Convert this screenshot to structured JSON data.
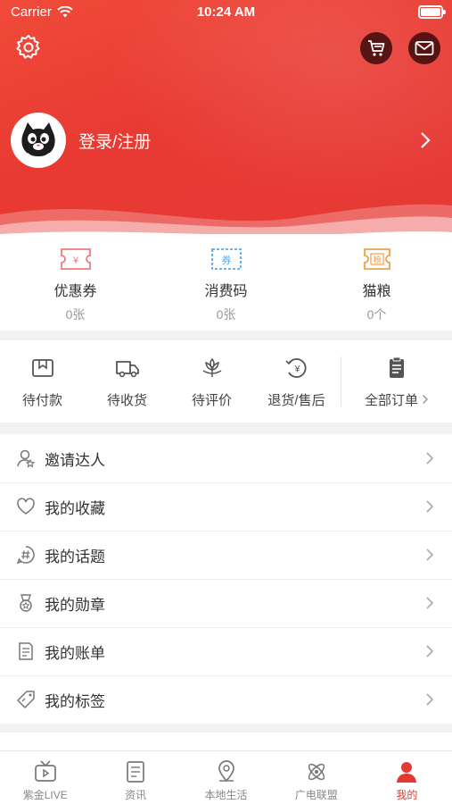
{
  "status_bar": {
    "carrier": "Carrier",
    "time": "10:24 AM"
  },
  "profile": {
    "login_label": "登录/注册"
  },
  "coupons": [
    {
      "name": "优惠券",
      "value": "0张",
      "icon": "coupon-icon",
      "color": "#f07b7b"
    },
    {
      "name": "消费码",
      "value": "0张",
      "icon": "voucher-icon",
      "color": "#5aa7e8"
    },
    {
      "name": "猫粮",
      "value": "0个",
      "icon": "cat-food-icon",
      "color": "#f0a24a"
    }
  ],
  "coupon_glyphs": {
    "voucher": "券",
    "cat_food": "粮",
    "yen": "¥"
  },
  "orders": [
    {
      "label": "待付款",
      "icon": "wallet-icon"
    },
    {
      "label": "待收货",
      "icon": "truck-icon"
    },
    {
      "label": "待评价",
      "icon": "flower-icon"
    },
    {
      "label": "退货/售后",
      "icon": "refund-icon"
    }
  ],
  "all_orders": {
    "label": "全部订单",
    "icon": "clipboard-icon"
  },
  "menu": [
    {
      "label": "邀请达人",
      "icon": "invite-user-icon"
    },
    {
      "label": "我的收藏",
      "icon": "heart-icon"
    },
    {
      "label": "我的话题",
      "icon": "hashtag-icon"
    },
    {
      "label": "我的勋章",
      "icon": "medal-icon"
    },
    {
      "label": "我的账单",
      "icon": "bill-icon"
    },
    {
      "label": "我的标签",
      "icon": "tag-icon"
    }
  ],
  "tabs": [
    {
      "label": "紫金LIVE",
      "icon": "tv-icon",
      "active": false
    },
    {
      "label": "资讯",
      "icon": "news-icon",
      "active": false
    },
    {
      "label": "本地生活",
      "icon": "location-icon",
      "active": false
    },
    {
      "label": "广电联盟",
      "icon": "atom-icon",
      "active": false
    },
    {
      "label": "我的",
      "icon": "user-icon",
      "active": true
    }
  ],
  "colors": {
    "brand_red": "#e83a32",
    "active_tab": "#e23a32"
  }
}
